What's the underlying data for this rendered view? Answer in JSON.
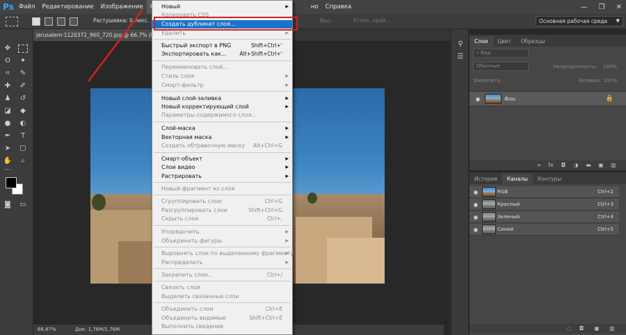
{
  "menubar": {
    "logo": "Ps",
    "items": [
      "Файл",
      "Редактирование",
      "Изображение",
      "Слои"
    ],
    "partial_item": "но",
    "help": "Справка",
    "window_controls": [
      "—",
      "❐",
      "✕"
    ]
  },
  "options": {
    "feather": "Растушевка:  0 пикс.",
    "right_a": "Выс:",
    "right_b": "Уточн. край...",
    "workspace": "Основная рабочая среда"
  },
  "document": {
    "tab": "jerusalem-1120372_960_720.jpg @ 66,7% (RGB/8",
    "zoom": "66,67%",
    "doc_size": "Док: 1,76M/1,76M"
  },
  "layers_panel": {
    "tabs": [
      "Слои",
      "Цвет",
      "Образцы"
    ],
    "search": "Вид",
    "blend_mode": "Обычные",
    "opacity_label": "Непрозрачность:",
    "opacity_value": "100%",
    "lock_label": "Закрепить:",
    "fill_label": "Заливка:",
    "fill_value": "100%",
    "layer_name": "Фон"
  },
  "channels_panel": {
    "tabs": [
      "История",
      "Каналы",
      "Контуры"
    ],
    "channels": [
      {
        "name": "RGB",
        "key": "Ctrl+2"
      },
      {
        "name": "Красный",
        "key": "Ctrl+3"
      },
      {
        "name": "Зеленый",
        "key": "Ctrl+4"
      },
      {
        "name": "Синий",
        "key": "Ctrl+5"
      }
    ]
  },
  "dropdown": {
    "items": [
      {
        "label": "Новый",
        "shortcut": "",
        "arrow": true,
        "disabled": false
      },
      {
        "label": "Копировать CSS",
        "shortcut": "",
        "arrow": false,
        "disabled": true
      },
      {
        "label": "Создать дубликат слоя...",
        "shortcut": "",
        "arrow": false,
        "disabled": false,
        "highlight": true
      },
      {
        "label": "Удалить",
        "shortcut": "",
        "arrow": true,
        "disabled": true
      },
      {
        "label": "Быстрый экспорт в PNG",
        "shortcut": "Shift+Ctrl+'",
        "arrow": false,
        "disabled": false
      },
      {
        "label": "Экспортировать как...",
        "shortcut": "Alt+Shift+Ctrl+'",
        "arrow": false,
        "disabled": false
      },
      {
        "label": "Переименовать слой...",
        "shortcut": "",
        "arrow": false,
        "disabled": true
      },
      {
        "label": "Стиль слоя",
        "shortcut": "",
        "arrow": true,
        "disabled": true
      },
      {
        "label": "Смарт-фильтр",
        "shortcut": "",
        "arrow": true,
        "disabled": true
      },
      {
        "label": "Новый слой-заливка",
        "shortcut": "",
        "arrow": true,
        "disabled": false
      },
      {
        "label": "Новый корректирующий слой",
        "shortcut": "",
        "arrow": true,
        "disabled": false
      },
      {
        "label": "Параметры содержимого слоя...",
        "shortcut": "",
        "arrow": false,
        "disabled": true
      },
      {
        "label": "Слой-маска",
        "shortcut": "",
        "arrow": true,
        "disabled": false
      },
      {
        "label": "Векторная маска",
        "shortcut": "",
        "arrow": true,
        "disabled": false
      },
      {
        "label": "Создать обтравочную маску",
        "shortcut": "Alt+Ctrl+G",
        "arrow": false,
        "disabled": true
      },
      {
        "label": "Смарт-объект",
        "shortcut": "",
        "arrow": true,
        "disabled": false
      },
      {
        "label": "Слои видео",
        "shortcut": "",
        "arrow": true,
        "disabled": false
      },
      {
        "label": "Растрировать",
        "shortcut": "",
        "arrow": true,
        "disabled": false
      },
      {
        "label": "Новый фрагмент из слоя",
        "shortcut": "",
        "arrow": false,
        "disabled": true
      },
      {
        "label": "Сгруппировать слои",
        "shortcut": "Ctrl+G",
        "arrow": false,
        "disabled": true
      },
      {
        "label": "Разгруппировать слои",
        "shortcut": "Shift+Ctrl+G",
        "arrow": false,
        "disabled": true
      },
      {
        "label": "Скрыть слои",
        "shortcut": "Ctrl+,",
        "arrow": false,
        "disabled": true
      },
      {
        "label": "Упорядочить",
        "shortcut": "",
        "arrow": true,
        "disabled": true
      },
      {
        "label": "Объединить фигуры",
        "shortcut": "",
        "arrow": true,
        "disabled": true
      },
      {
        "label": "Выровнять слои по выделенному фрагменту",
        "shortcut": "",
        "arrow": true,
        "disabled": true
      },
      {
        "label": "Распределить",
        "shortcut": "",
        "arrow": true,
        "disabled": true
      },
      {
        "label": "Закрепить слои...",
        "shortcut": "Ctrl+/",
        "arrow": false,
        "disabled": true
      },
      {
        "label": "Связать слои",
        "shortcut": "",
        "arrow": false,
        "disabled": true
      },
      {
        "label": "Выделить связанные слои",
        "shortcut": "",
        "arrow": false,
        "disabled": true
      },
      {
        "label": "Объединить слои",
        "shortcut": "Ctrl+E",
        "arrow": false,
        "disabled": true
      },
      {
        "label": "Объединить видимые",
        "shortcut": "Shift+Ctrl+E",
        "arrow": false,
        "disabled": true
      },
      {
        "label": "Выполнить сведение",
        "shortcut": "",
        "arrow": false,
        "disabled": true
      }
    ]
  },
  "colors": {
    "accent": "#1a73c8",
    "annotation": "#d42020",
    "ps_blue": "#31a8ff"
  }
}
